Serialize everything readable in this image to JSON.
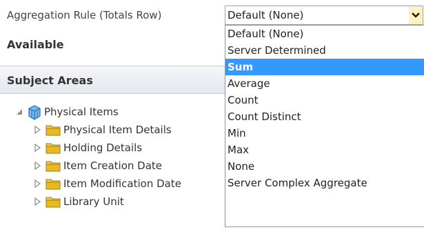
{
  "aggregation": {
    "label": "Aggregation Rule (Totals Row)",
    "selected_value": "Default (None)",
    "options": [
      "Default (None)",
      "Server Determined",
      "Sum",
      "Average",
      "Count",
      "Count Distinct",
      "Min",
      "Max",
      "None",
      "Server Complex Aggregate"
    ],
    "highlighted_option": "Sum"
  },
  "available": {
    "heading": "Available"
  },
  "subject_areas": {
    "header": "Subject Areas",
    "root": {
      "label": "Physical Items",
      "icon": "cube-icon",
      "expanded": true
    },
    "children": [
      {
        "label": "Physical Item Details",
        "icon": "folder-icon"
      },
      {
        "label": "Holding Details",
        "icon": "folder-icon"
      },
      {
        "label": "Item Creation Date",
        "icon": "folder-icon"
      },
      {
        "label": "Item Modification Date",
        "icon": "folder-icon"
      },
      {
        "label": "Library Unit",
        "icon": "folder-icon"
      }
    ]
  },
  "colors": {
    "highlight": "#3399ff",
    "folder": "#e8b923",
    "cube": "#2a7fd4",
    "dropdown_arrow_bg": "#fdf1c0"
  }
}
